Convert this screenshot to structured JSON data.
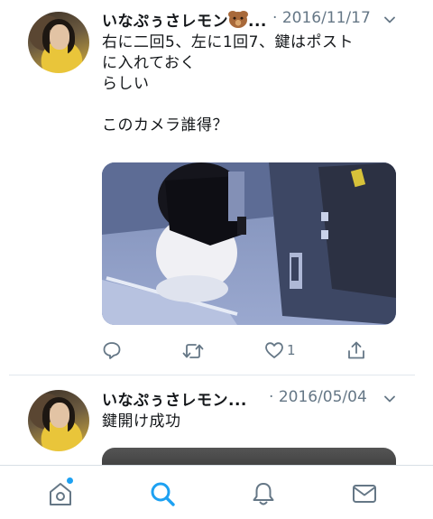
{
  "tweets": [
    {
      "author": "いなぷぅさレモン",
      "author_emoji": "bear-face-emoji",
      "ellipsis": "...",
      "separator": "·",
      "date": "2016/11/17",
      "text": "右に二回5、左に1回7、鍵はポスト\nに入れておく\nらしい\n\nこのカメラ誰得？",
      "media": "surveillance-camera-image",
      "actions": {
        "reply_count": "",
        "retweet_count": "",
        "like_count": "1",
        "share_count": ""
      }
    },
    {
      "author": "いなぷぅさレモン...",
      "separator": "·",
      "date": "2016/05/04",
      "text": "鍵開け成功"
    }
  ],
  "tabbar": {
    "items": [
      "home-icon",
      "search-icon",
      "notifications-icon",
      "messages-icon"
    ],
    "active": "search-icon",
    "home_has_new": true
  },
  "colors": {
    "accent": "#1da1f2",
    "text": "#14171a",
    "secondary": "#657786",
    "divider": "#e1e8ed"
  }
}
